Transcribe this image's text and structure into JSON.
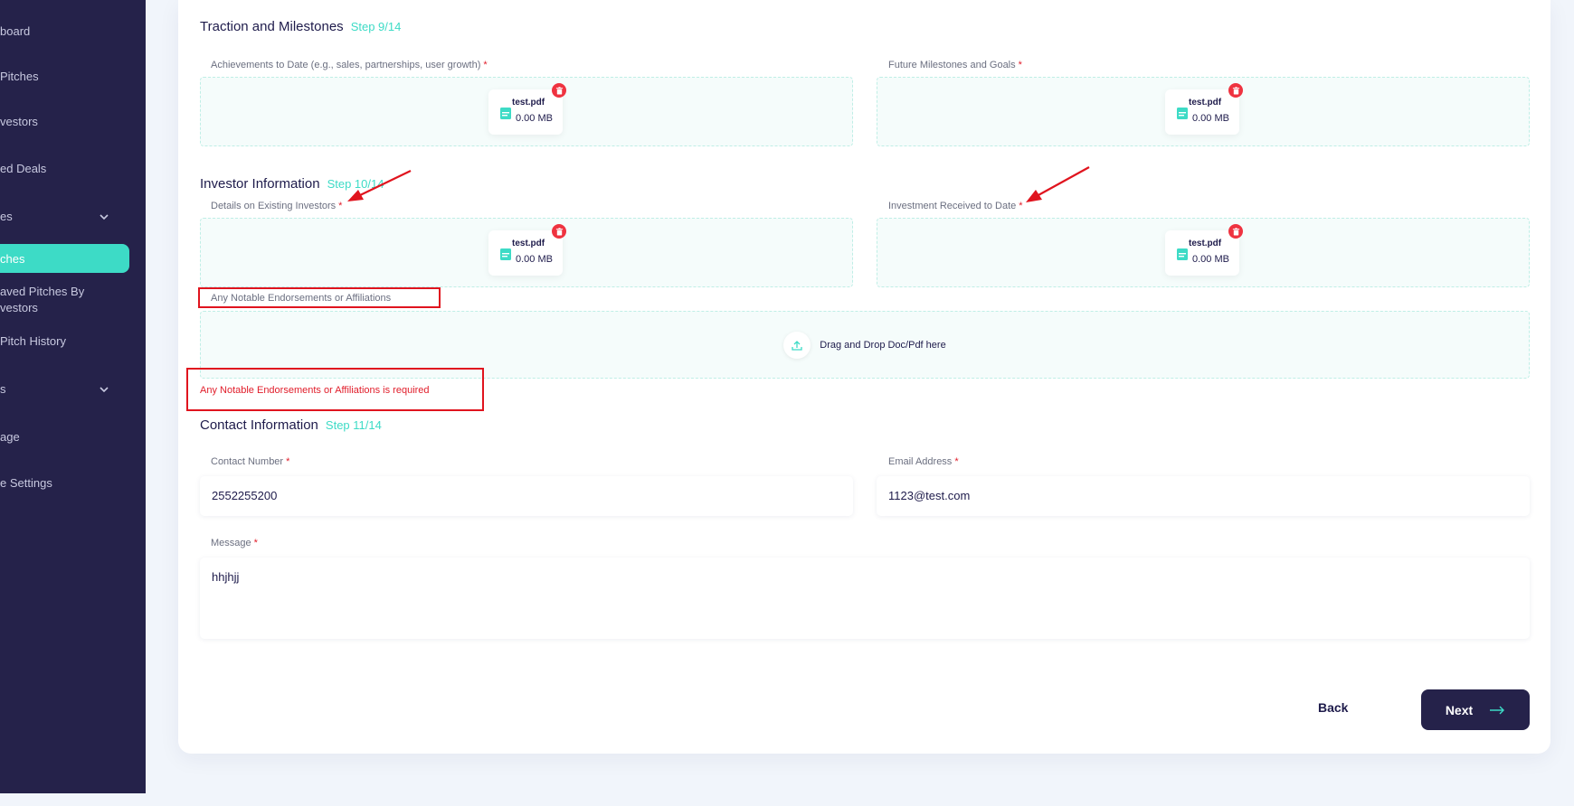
{
  "sidebar": {
    "items": [
      {
        "label": "board"
      },
      {
        "label": "Pitches"
      },
      {
        "label": "vestors"
      },
      {
        "label": "ed Deals"
      },
      {
        "label": "es"
      },
      {
        "label": "ches"
      },
      {
        "label": "aved Pitches By"
      },
      {
        "label": "vestors"
      },
      {
        "label": "Pitch History"
      },
      {
        "label": "s"
      },
      {
        "label": "age"
      },
      {
        "label": "e Settings"
      }
    ]
  },
  "sections": {
    "traction": {
      "title": "Traction and Milestones",
      "step": "Step 9/14"
    },
    "investor": {
      "title": "Investor Information",
      "step": "Step 10/14"
    },
    "contact": {
      "title": "Contact Information",
      "step": "Step 11/14"
    }
  },
  "fields": {
    "achievements": {
      "label": "Achievements to Date (e.g., sales, partnerships, user growth)",
      "required": "*"
    },
    "future": {
      "label": "Future Milestones and Goals",
      "required": "*"
    },
    "existing_investors": {
      "label": "Details on Existing Investors",
      "required": "*"
    },
    "investment_received": {
      "label": "Investment Received to Date",
      "required": "*"
    },
    "endorsements": {
      "label": "Any Notable Endorsements or Affiliations",
      "drop_text": "Drag and Drop Doc/Pdf here",
      "error": "Any Notable Endorsements or Affiliations is required"
    },
    "contact_number": {
      "label": "Contact Number",
      "required": "*",
      "value": "2552255200"
    },
    "email": {
      "label": "Email Address",
      "required": "*",
      "value": "1123@test.com"
    },
    "message": {
      "label": "Message",
      "required": "*",
      "value": "hhjhjj"
    }
  },
  "file": {
    "name": "test.pdf",
    "size": "0.00 MB",
    "icon": "file-icon"
  },
  "buttons": {
    "back": "Back",
    "next": "Next"
  },
  "colors": {
    "sidebar": "#25224a",
    "accent": "#3ddbc6",
    "error": "#e11d2a",
    "annotation": "#e0141e"
  }
}
